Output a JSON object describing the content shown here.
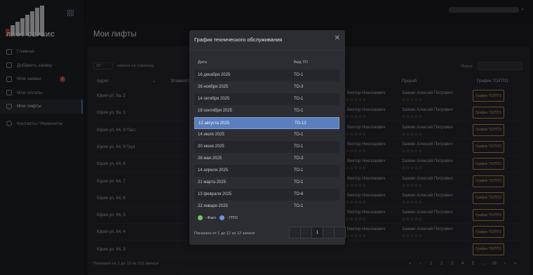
{
  "brand": {
    "name": "ЛИФТ-СЕРВИС"
  },
  "sidebar": {
    "items": [
      {
        "label": "Главная",
        "icon": "home-icon"
      },
      {
        "label": "Добавить заявку",
        "icon": "edit-icon"
      },
      {
        "label": "Мои заявки",
        "icon": "list-icon",
        "badge": "1"
      },
      {
        "label": "Мои оплаты",
        "icon": "payment-icon"
      },
      {
        "label": "Мои лифты",
        "icon": "shield-icon",
        "active": true
      },
      {
        "label": "Контакты / Реквизиты",
        "icon": "phone-icon"
      }
    ]
  },
  "page": {
    "title": "Мои лифты"
  },
  "table": {
    "entries_value": "10",
    "entries_label": "записи на страницу",
    "search_label": "Поиск:",
    "headers": {
      "address": "Адрес",
      "floors": "Этажность",
      "foreman": "Прораб",
      "schedule": "График ТО/ПТО"
    },
    "rows": [
      {
        "address": "Юрия ул, 9а, 2",
        "mechanic": "Виктор Николаевич",
        "foreman": "Заякин Алексей Петрович",
        "button": "График ТО/ПТО"
      },
      {
        "address": "Юрия ул, 9а, 1",
        "mechanic": "Виктор Николаевич",
        "foreman": "Заякин Алексей Петрович",
        "button": "График ТО/ПТО"
      },
      {
        "address": "Юрия ул, 64, 9 Пасс",
        "mechanic": "Виктор Николаевич",
        "foreman": "Заякин Алексей Петрович",
        "button": "График ТО/ПТО"
      },
      {
        "address": "Юрия ул, 64, 9 Груз",
        "mechanic": "Виктор Николаевич",
        "foreman": "Заякин Алексей Петрович",
        "button": "График ТО/ПТО"
      },
      {
        "address": "Юрия ул, 64, 8",
        "mechanic": "Виктор Николаевич",
        "foreman": "Заякин Алексей Петрович",
        "button": "График ТО/ПТО"
      },
      {
        "address": "Юрия ул, 64, 7",
        "mechanic": "Виктор Николаевич",
        "foreman": "Заякин Алексей Петрович",
        "button": "График ТО/ПТО"
      },
      {
        "address": "Юрия ул, 64, 6",
        "mechanic": "Виктор Николаевич",
        "foreman": "Заякин Алексей Петрович",
        "button": "График ТО/ПТО"
      },
      {
        "address": "Юрия ул, 64, 5",
        "mechanic": "Виктор Николаевич",
        "foreman": "Заякин Алексей Петрович",
        "button": "График ТО/ПТО"
      },
      {
        "address": "Юрия ул, 64, 4",
        "mechanic": "Виктор Николаевич",
        "foreman": "Заякин Алексей Петрович",
        "button": "График ТО/ПТО"
      },
      {
        "address": "Юрия ул, 64, 3",
        "mechanic": "",
        "foreman": "",
        "button": "График ТО/ПТО"
      }
    ],
    "footer": "Показано от 1 до 10 из 152 записи",
    "pages": [
      "«",
      "‹",
      "1",
      "2",
      "3",
      "4",
      "5",
      "…",
      "16",
      "›",
      "»"
    ]
  },
  "modal": {
    "title": "График технического обслуживания",
    "headers": {
      "date": "Дата",
      "type": "Вид ТО"
    },
    "rows": [
      {
        "date": "16 декабря 2025",
        "type": "ТО-1"
      },
      {
        "date": "26 ноября 2025",
        "type": "ТО-3"
      },
      {
        "date": "14 октября 2025",
        "type": "ТО-1"
      },
      {
        "date": "18 сентября 2025",
        "type": "ТО-1"
      },
      {
        "date": "12 августа 2025",
        "type": "ТО-12",
        "selected": true
      },
      {
        "date": "14 июля 2025",
        "type": "ТО-1"
      },
      {
        "date": "20 июня 2025",
        "type": "ТО-1"
      },
      {
        "date": "28 мая 2025",
        "type": "ТО-3"
      },
      {
        "date": "14 апреля 2025",
        "type": "ТО-1"
      },
      {
        "date": "21 марта 2025",
        "type": "ТО-1"
      },
      {
        "date": "13 февраля 2025",
        "type": "ТО-6"
      },
      {
        "date": "22 января 2025",
        "type": "ТО-1"
      }
    ],
    "legend": {
      "fact": "- Факт",
      "pto": "- ПТО",
      "fact_color": "#7cc36a",
      "pto_color": "#6f97d6"
    },
    "info": "Показано от 1 до 12 из 12 записи",
    "page": "1"
  },
  "colors": {
    "accent": "#5b7fbe",
    "button_border": "#b98a3e",
    "badge": "#b5493f"
  }
}
